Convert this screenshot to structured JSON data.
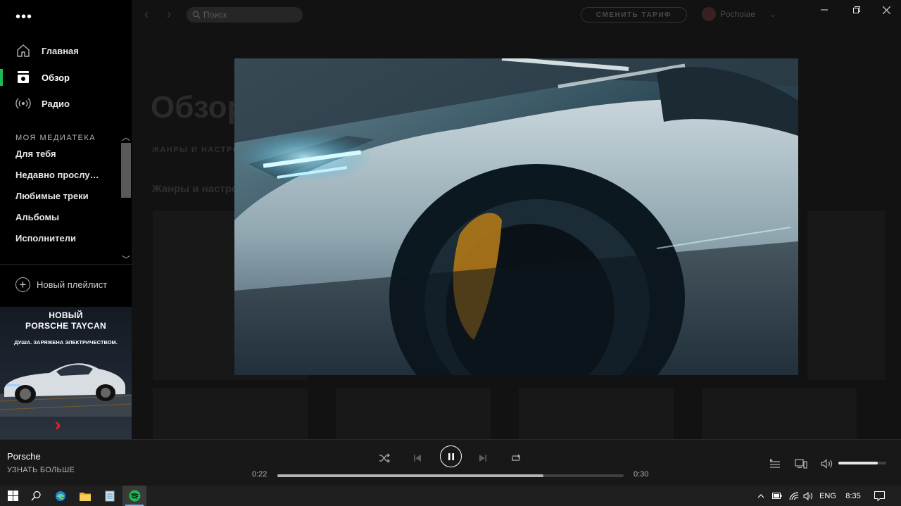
{
  "window": {
    "minimize_icon": "minimize-icon",
    "maximize_icon": "maximize-icon",
    "close_icon": "close-icon"
  },
  "sidebar": {
    "menu_icon": "more-dots-icon",
    "nav": [
      {
        "label": "Главная",
        "icon": "home-icon"
      },
      {
        "label": "Обзор",
        "icon": "browse-icon",
        "active": true
      },
      {
        "label": "Радио",
        "icon": "radio-icon"
      }
    ],
    "library_title": "МОЯ МЕДИАТЕКА",
    "library": [
      "Для тебя",
      "Недавно прослушано",
      "Любимые треки",
      "Альбомы",
      "Исполнители"
    ],
    "new_playlist": "Новый плейлист"
  },
  "ad": {
    "line1": "НОВЫЙ",
    "line2": "PORSCHE TAYCAN",
    "tagline": "ДУША. ЗАРЯЖЕНА ЭЛЕКТРИЧЕСТВОМ."
  },
  "topbar": {
    "search_placeholder": "Поиск",
    "upgrade": "СМЕНИТЬ ТАРИФ",
    "user": "Pochoiae"
  },
  "main": {
    "title": "Обзор",
    "tab": "ЖАНРЫ И НАСТРОЕНИЯ",
    "section": "Жанры и настроения"
  },
  "player": {
    "title": "Porsche",
    "subtitle": "УЗНАТЬ БОЛЬШЕ",
    "elapsed": "0:22",
    "total": "0:30",
    "progress": 0.768,
    "volume": 0.82
  },
  "taskbar": {
    "language": "ENG",
    "clock": "8:35"
  },
  "colors": {
    "accent": "#1db954",
    "background": "#121212",
    "sidebar": "#000000",
    "player": "#181818"
  }
}
